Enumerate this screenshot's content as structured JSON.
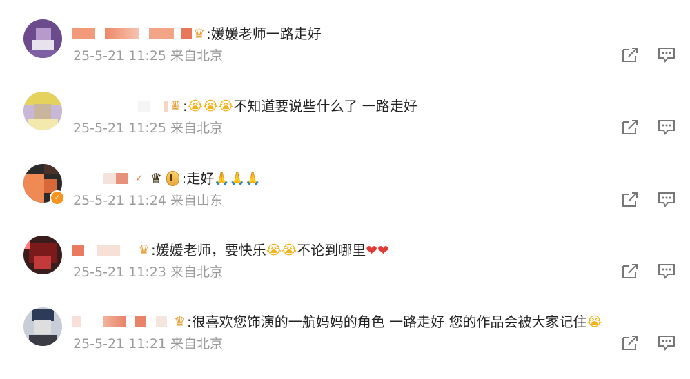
{
  "comments": [
    {
      "text": ":媛媛老师一路走好",
      "emojis": [],
      "time": "25-5-21 11:25",
      "location": "来自北京",
      "badge_icon": "crown-fan-badge-icon",
      "avatar_colors": [
        "#6b4b8c",
        "#b59acb",
        "#e8e2ef",
        "#7e5fa3"
      ]
    },
    {
      "text": "不知道要说些什么了 一路走好",
      "emojis": [
        "😭",
        "😭",
        "😭"
      ],
      "time": "25-5-21 11:25",
      "location": "来自北京",
      "badge_icon": "crown-fan-badge-icon",
      "avatar_colors": [
        "#e5d25d",
        "#c8b59c",
        "#f3e9ac",
        "#c7b8d8"
      ]
    },
    {
      "text": ":走好",
      "emojis": [
        "🙏",
        "🙏",
        "🙏"
      ],
      "time": "25-5-21 11:24",
      "location": "来自山东",
      "badge_icon": "crown-level-badge-icon",
      "level": "I",
      "avatar_colors": [
        "#f08a55",
        "#2a2a2a",
        "#d7683a",
        "#4a3228"
      ]
    },
    {
      "text": ":媛媛老师，要快乐",
      "text_after": "不论到哪里",
      "emojis": [
        "😭",
        "😭"
      ],
      "hearts": [
        "❤",
        "❤"
      ],
      "time": "25-5-21 11:23",
      "location": "来自北京",
      "badge_icon": "crown-fan-badge-icon",
      "avatar_colors": [
        "#7b1a1a",
        "#3a1c1c",
        "#c23a3a",
        "#ff7a7a"
      ]
    },
    {
      "text": ":很喜欢您饰演的一航妈妈的角色 一路走好 您的作品会被大家记住",
      "emojis": [
        "😭"
      ],
      "time": "25-5-21 11:21",
      "location": "来自北京",
      "badge_icon": "crown-fan-badge-icon",
      "avatar_colors": [
        "#2d3a58",
        "#dedede",
        "#c8ced8",
        "#3b3b45"
      ]
    }
  ],
  "icons": {
    "share": "share-icon",
    "reply": "reply-icon"
  }
}
